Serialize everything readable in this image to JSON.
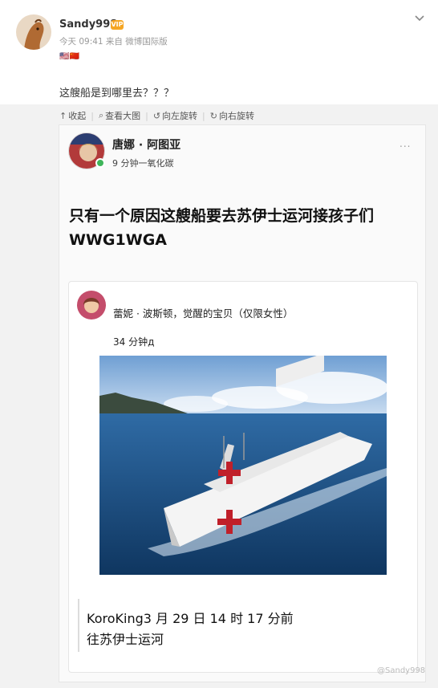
{
  "post": {
    "username": "Sandy998",
    "vip_badge": "VIP",
    "meta": "今天 09:41 来自 微博国际版",
    "flags": "🇺🇸🇨🇳",
    "text": "这艘船是到哪里去？？？"
  },
  "toolbar": {
    "collapse": "收起",
    "view_large": "查看大图",
    "rotate_left": "向左旋转",
    "rotate_right": "向右旋转"
  },
  "screenshot": {
    "author": "唐娜 · 阿图亚",
    "time": "9 分钟一氧化碳",
    "dots": "...",
    "body": "只有一个原因这艘船要去苏伊士运河接孩子们 WWG1WGA",
    "shared": {
      "author": "蕾妮 · 波斯顿，觉醒的宝贝（仅限女性）",
      "time": "34 分钟д",
      "quote": "KoroKing3 月 29 日 14 时 17 分前往苏伊士运河"
    }
  },
  "watermark": "@Sandy998",
  "colors": {
    "accent_green": "#3fb55a",
    "vip_orange": "#f5a623"
  }
}
